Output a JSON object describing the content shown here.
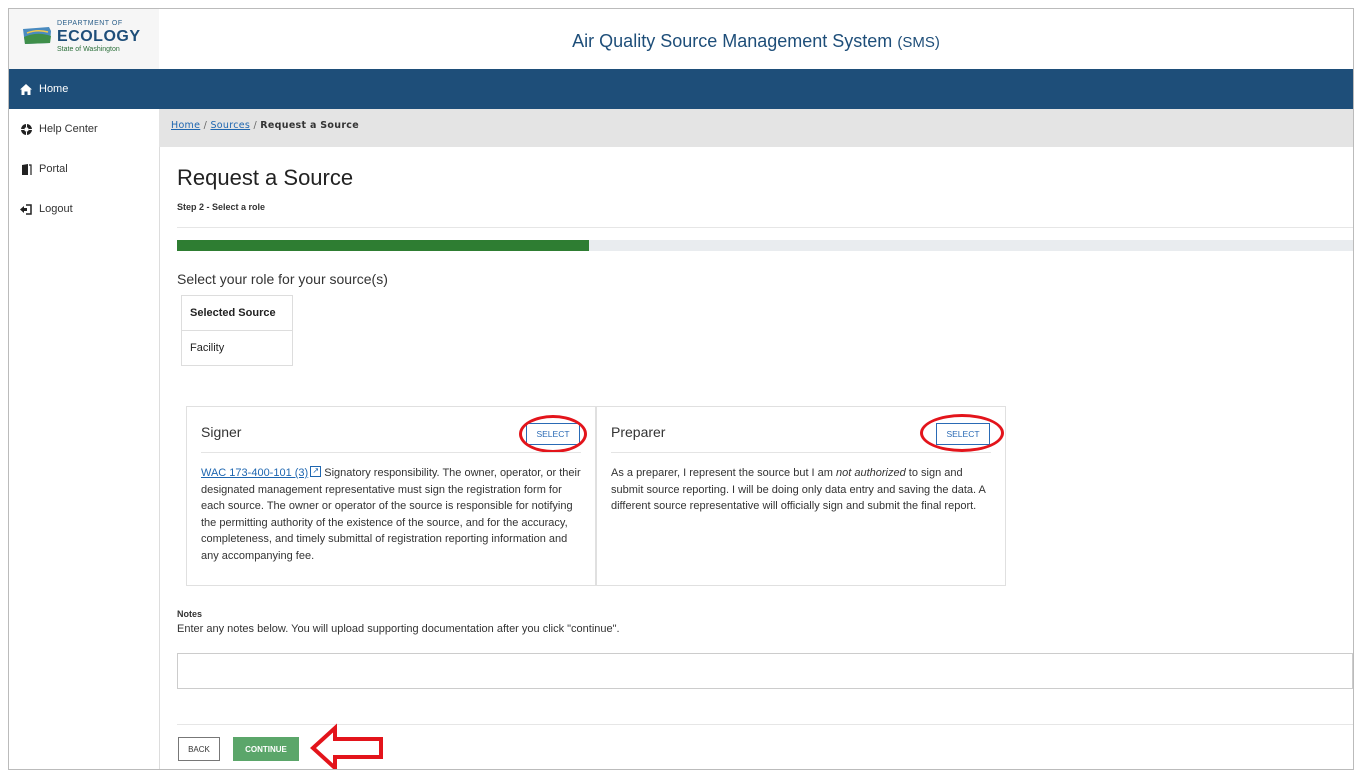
{
  "header": {
    "logo": {
      "dept": "DEPARTMENT OF",
      "name": "ECOLOGY",
      "state": "State of Washington"
    },
    "title": "Air Quality Source Management System",
    "title_abbr": "(SMS)"
  },
  "sidebar": {
    "items": [
      {
        "label": "Home",
        "icon": "home-icon"
      },
      {
        "label": "Help Center",
        "icon": "help-icon"
      },
      {
        "label": "Portal",
        "icon": "door-icon"
      },
      {
        "label": "Logout",
        "icon": "logout-icon"
      }
    ]
  },
  "breadcrumb": {
    "home": "Home",
    "sources": "Sources",
    "current": "Request a Source",
    "sep": "/"
  },
  "page": {
    "title": "Request a Source",
    "step": "Step 2 - Select a role",
    "progress_fraction": 0.35,
    "role_prompt": "Select your role for your source(s)",
    "source_table": {
      "header": "Selected Source",
      "rows": [
        "Facility"
      ]
    }
  },
  "signer": {
    "title": "Signer",
    "select_label": "SELECT",
    "link": "WAC 173-400-101 (3)",
    "body": " Signatory responsibility. The owner, operator, or their designated management representative must sign the registration form for each source. The owner or operator of the source is responsible for notifying the permitting authority of the existence of the source, and for the accuracy, completeness, and timely submittal of registration reporting information and any accompanying fee."
  },
  "preparer": {
    "title": "Preparer",
    "select_label": "SELECT",
    "body_before": "As a preparer, I represent the source but I am ",
    "body_em": "not authorized",
    "body_after": " to sign and submit source reporting. I will be doing only data entry and saving the data. A different source representative will officially sign and submit the final report."
  },
  "notes": {
    "label": "Notes",
    "help": "Enter any notes below. You will upload supporting documentation after you click \"continue\".",
    "value": ""
  },
  "actions": {
    "back": "BACK",
    "continue": "CONTINUE"
  },
  "colors": {
    "primary": "#1e4e79",
    "progress": "#2e7d32",
    "continue": "#5ba66a",
    "annotation": "#e3141b"
  }
}
